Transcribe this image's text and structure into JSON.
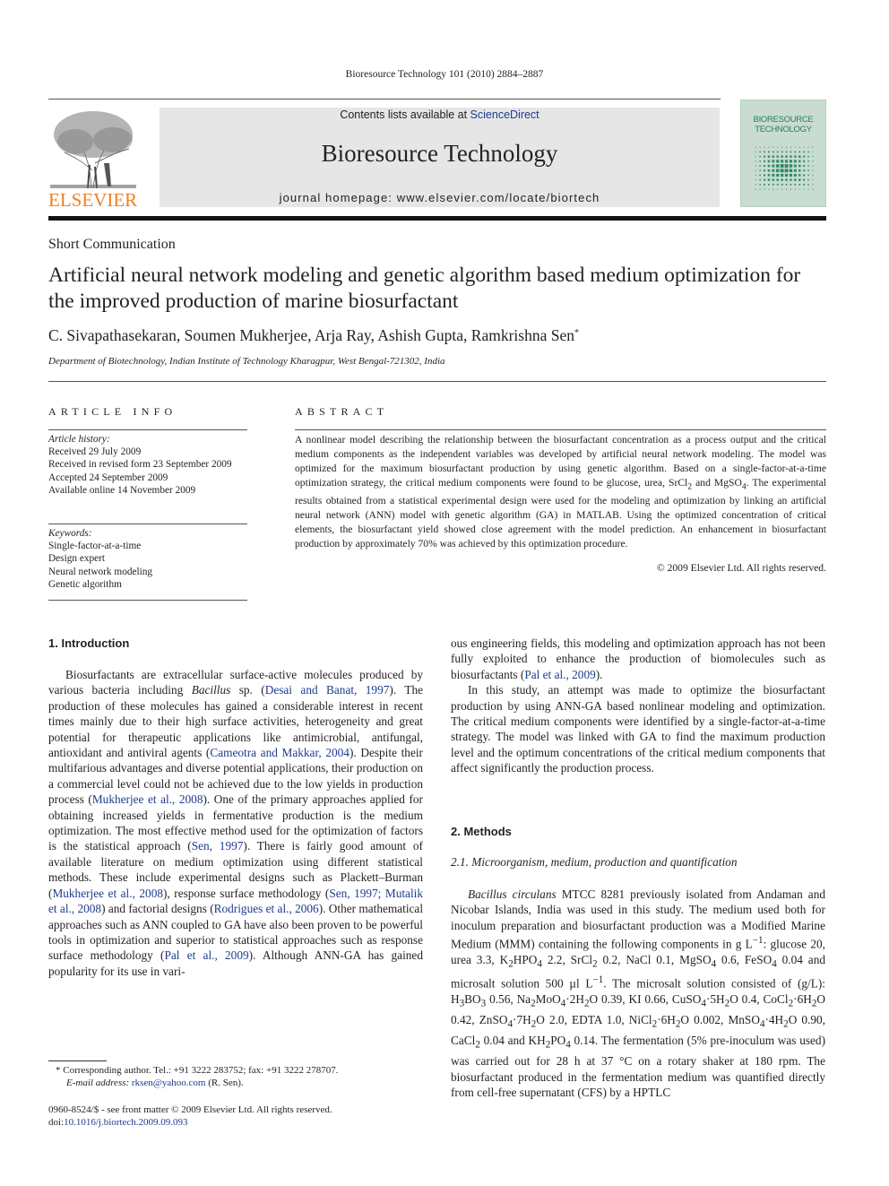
{
  "header": {
    "journal_ref": "Bioresource Technology 101 (2010) 2884–2887",
    "publisher_wordmark": "ELSEVIER",
    "contents_prefix": "Contents lists available at ",
    "contents_link": "ScienceDirect",
    "journal_title": "Bioresource Technology",
    "homepage": "journal homepage: www.elsevier.com/locate/biortech",
    "cover_title_line1": "BIORESOURCE",
    "cover_title_line2": "TECHNOLOGY",
    "colors": {
      "elsevier_orange": "#f07f1f",
      "link_blue": "#1d3c8f",
      "masthead_gray": "#e6e6e6",
      "cover_green": "#c8dcd2"
    }
  },
  "article": {
    "type": "Short Communication",
    "title": "Artificial neural network modeling and genetic algorithm based medium optimization for the improved production of marine biosurfactant",
    "authors": "C. Sivapathasekaran, Soumen Mukherjee, Arja Ray, Ashish Gupta, Ramkrishna Sen",
    "author_mark": "*",
    "affiliation": "Department of Biotechnology, Indian Institute of Technology Kharagpur, West Bengal-721302, India"
  },
  "article_info": {
    "heading": "ARTICLE INFO",
    "history_label": "Article history:",
    "history": [
      "Received 29 July 2009",
      "Received in revised form 23 September 2009",
      "Accepted 24 September 2009",
      "Available online 14 November 2009"
    ],
    "keywords_label": "Keywords:",
    "keywords": [
      "Single-factor-at-a-time",
      "Design expert",
      "Neural network modeling",
      "Genetic algorithm"
    ]
  },
  "abstract": {
    "heading": "ABSTRACT",
    "p1": "A nonlinear model describing the relationship between the biosurfactant concentration as a process output and the critical medium components as the independent variables was developed by artificial neural network modeling. The model was optimized for the maximum biosurfactant production by using genetic algorithm. Based on a single-factor-at-a-time optimization strategy, the critical medium components were found to be glucose, urea, SrCl",
    "p2": " and MgSO",
    "p3": ". The experimental results obtained from a statistical experimental design were used for the modeling and optimization by linking an artificial neural network (ANN) model with genetic algorithm (GA) in MATLAB. Using the optimized concentration of critical elements, the biosurfactant yield showed close agreement with the model prediction. An enhancement in biosurfactant production by approximately 70% was achieved by this optimization procedure.",
    "copyright": "© 2009 Elsevier Ltd. All rights reserved."
  },
  "introduction": {
    "heading": "1. Introduction",
    "t1": "Biosurfactants are extracellular surface-active molecules produced by various bacteria including ",
    "t1_ital": "Bacillus",
    "t1b": " sp. (",
    "c1": "Desai and Banat, 1997",
    "t2": "). The production of these molecules has gained a considerable interest in recent times mainly due to their high surface activities, heterogeneity and great potential for therapeutic applications like antimicrobial, antifungal, antioxidant and antiviral agents (",
    "c2": "Cameotra and Makkar, 2004",
    "t3": "). Despite their multifarious advantages and diverse potential applications, their production on a commercial level could not be achieved due to the low yields in production process (",
    "c3": "Mukherjee et al., 2008",
    "t4": "). One of the primary approaches applied for obtaining increased yields in fermentative production is the medium optimization. The most effective method used for the optimization of factors is the statistical approach (",
    "c4": "Sen, 1997",
    "t5": "). There is fairly good amount of available literature on medium optimization using different statistical methods. These include experimental designs such as Plackett–Burman (",
    "c5": "Mukherjee et al., 2008",
    "t6": "), response surface methodology (",
    "c6": "Sen, 1997; Mutalik et al., 2008",
    "t7": ") and factorial designs (",
    "c7": "Rodrigues et al., 2006",
    "t8": "). Other mathematical approaches such as ANN coupled to GA have also been proven to be powerful tools in optimization and superior to statistical approaches such as response surface methodology (",
    "c8": "Pal et al., 2009",
    "t9": "). Although ANN-GA has gained popularity for its use in various engineering fields, this modeling and optimization approach has not been fully exploited to enhance the production of biomolecules such as biosurfactants (",
    "c9": "Pal et al., 2009",
    "t10": ").",
    "p2": "In this study, an attempt was made to optimize the biosurfactant production by using ANN-GA based nonlinear modeling and optimization. The critical medium components were identified by a single-factor-at-a-time strategy. The model was linked with GA to find the maximum production level and the optimum concentrations of the critical medium components that affect significantly the production process."
  },
  "methods": {
    "heading": "2. Methods",
    "subheading": "2.1. Microorganism, medium, production and quantification",
    "organism": "Bacillus circulans",
    "m1": " MTCC 8281 previously isolated from Andaman and Nicobar Islands, India was used in this study. The medium used both for inoculum preparation and biosurfactant production was a Modified Marine Medium (MMM) containing the following components in g L",
    "m2": ": glucose 20, urea 3.3, K",
    "m3": "HPO",
    "m4": " 2.2, SrCl",
    "m5": " 0.2, NaCl 0.1, MgSO",
    "m6": " 0.6, FeSO",
    "m7": " 0.04 and microsalt solution 500 µl L",
    "m8": ". The microsalt solution consisted of (g/L): H",
    "m9": "BO",
    "m10": " 0.56, Na",
    "m11": "MoO",
    "m12": "·2H",
    "m13": "O 0.39, KI 0.66, CuSO",
    "m14": "·5H",
    "m15": "O 0.4, CoCl",
    "m16": "·6H",
    "m17": "O 0.42, ZnSO",
    "m18": "·7H",
    "m19": "O 2.0, EDTA 1.0, NiCl",
    "m20": "·6H",
    "m21": "O 0.002, MnSO",
    "m22": "·4H",
    "m23": "O 0.90, CaCl",
    "m24": " 0.04 and KH",
    "m25": "PO",
    "m26": " 0.14. The fermentation (5% pre-inoculum was used) was carried out for 28 h at 37 °C on a rotary shaker at 180 rpm. The biosurfactant produced in the fermentation medium was quantified directly from cell-free supernatant (CFS) by a HPTLC"
  },
  "footnote": {
    "mark": "*",
    "corresponding": " Corresponding author. Tel.: +91 3222 283752; fax: +91 3222 278707.",
    "email_label": "E-mail address:",
    "email": "rksen@yahoo.com",
    "email_suffix": " (R. Sen)."
  },
  "front_matter": {
    "issn_line": "0960-8524/$ - see front matter © 2009 Elsevier Ltd. All rights reserved.",
    "doi_prefix": "doi:",
    "doi": "10.1016/j.biortech.2009.09.093"
  },
  "subscripts": {
    "two": "2",
    "three": "3",
    "four": "4",
    "minus_one": "−1"
  }
}
